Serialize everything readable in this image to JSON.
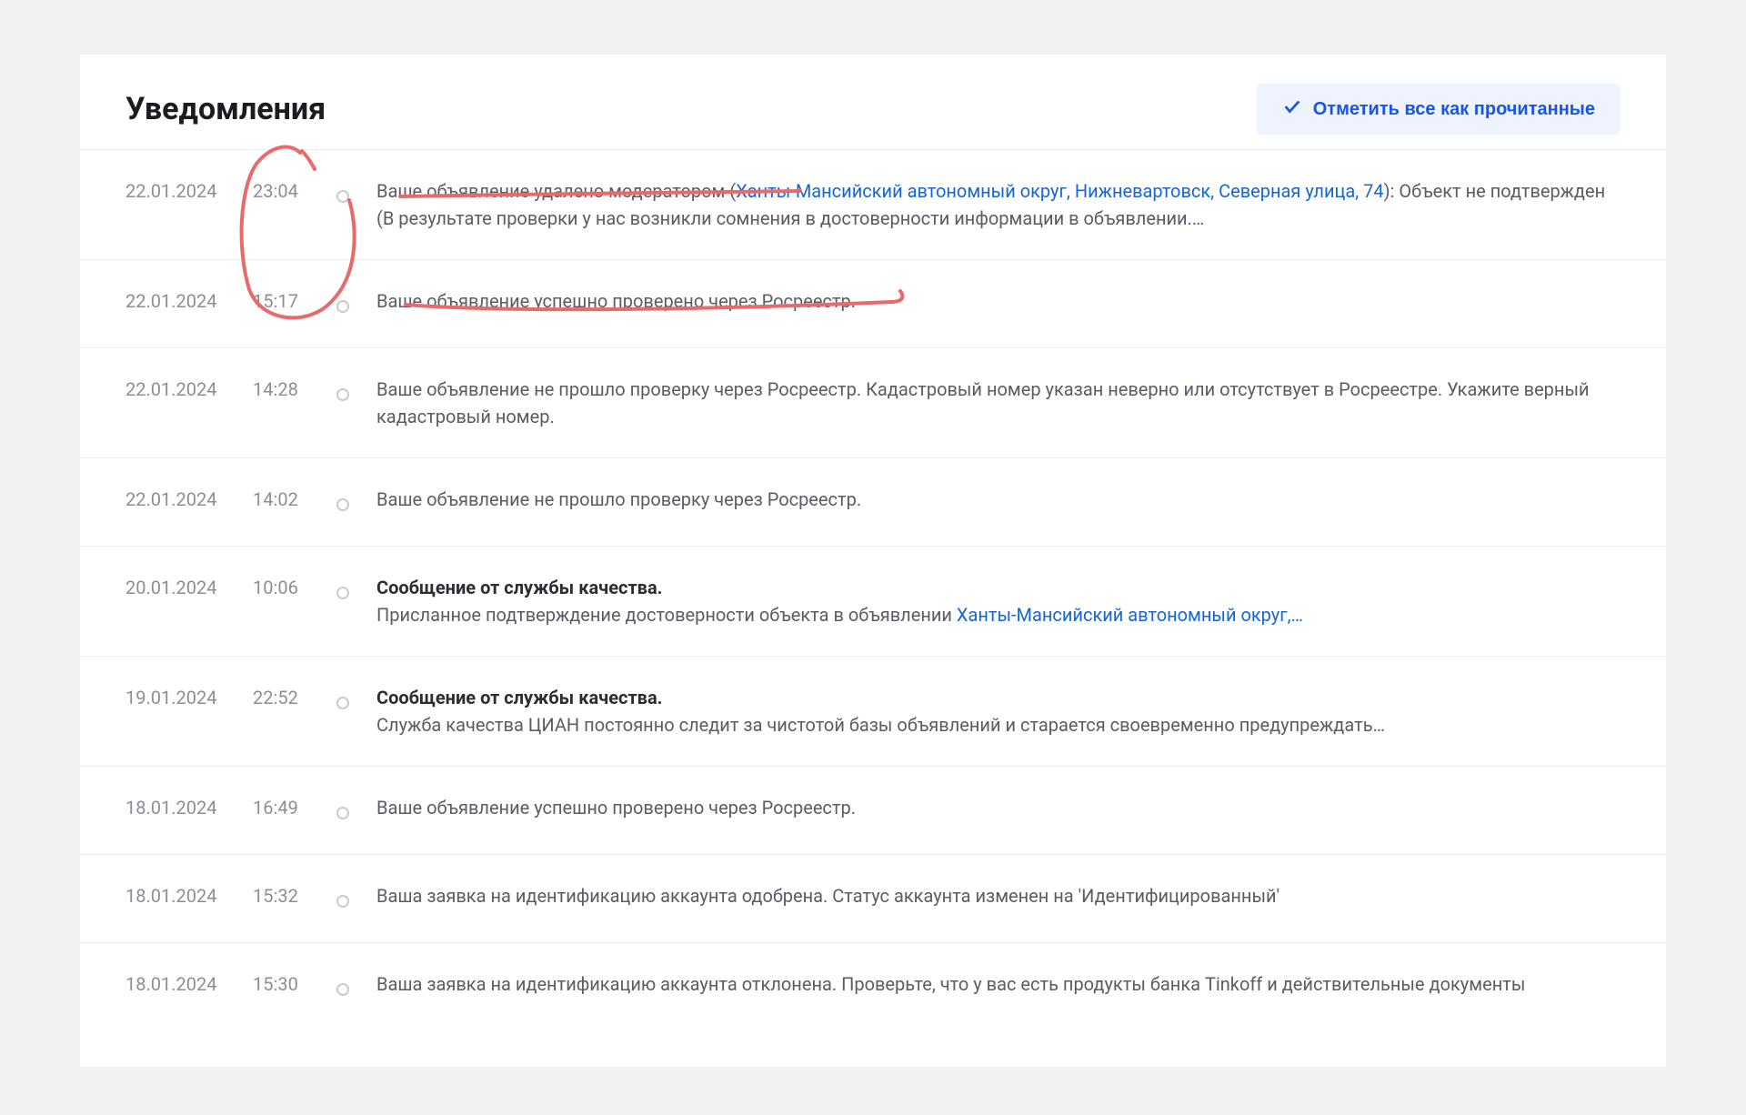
{
  "header": {
    "title": "Уведомления",
    "mark_all_label": "Отметить все как прочитанные"
  },
  "notifications": [
    {
      "date": "22.01.2024",
      "time": "23:04",
      "unread": true,
      "body_prefix": "Ваше объявление удалено модератором (",
      "link": "Ханты-Мансийский автономный округ, Нижневартовск, Северная улица, 74",
      "body_after_link": "): Объект не подтвержден (В результате проверки у нас возникли сомнения в достоверности информации в объявлении.…"
    },
    {
      "date": "22.01.2024",
      "time": "15:17",
      "unread": true,
      "body_prefix": "Ваше объявление успешно проверено через Росреестр.",
      "link": "",
      "body_after_link": ""
    },
    {
      "date": "22.01.2024",
      "time": "14:28",
      "unread": true,
      "body_prefix": "Ваше объявление не прошло проверку через Росреестр. Кадастровый номер указан неверно или отсутствует в Росреестре. Укажите верный кадастровый номер.",
      "link": "",
      "body_after_link": ""
    },
    {
      "date": "22.01.2024",
      "time": "14:02",
      "unread": true,
      "body_prefix": "Ваше объявление не прошло проверку через Росреестр.",
      "link": "",
      "body_after_link": ""
    },
    {
      "date": "20.01.2024",
      "time": "10:06",
      "unread": true,
      "strong": "Сообщение от службы качества.",
      "body_prefix": "Присланное подтверждение достоверности объекта в объявлении ",
      "link": "Ханты-Мансийский автономный округ,…",
      "body_after_link": ""
    },
    {
      "date": "19.01.2024",
      "time": "22:52",
      "unread": true,
      "strong": "Сообщение от службы качества.",
      "body_prefix": "Служба качества ЦИАН постоянно следит за чистотой базы объявлений и старается своевременно предупреждать…",
      "link": "",
      "body_after_link": ""
    },
    {
      "date": "18.01.2024",
      "time": "16:49",
      "unread": true,
      "body_prefix": "Ваше объявление успешно проверено через Росреестр.",
      "link": "",
      "body_after_link": ""
    },
    {
      "date": "18.01.2024",
      "time": "15:32",
      "unread": true,
      "body_prefix": "Ваша заявка на идентификацию аккаунта одобрена. Статус аккаунта изменен на 'Идентифицированный'",
      "link": "",
      "body_after_link": ""
    },
    {
      "date": "18.01.2024",
      "time": "15:30",
      "unread": true,
      "body_prefix": "Ваша заявка на идентификацию аккаунта отклонена. Проверьте, что у вас есть продукты банка Tinkoff и действительные документы",
      "link": "",
      "body_after_link": ""
    }
  ]
}
